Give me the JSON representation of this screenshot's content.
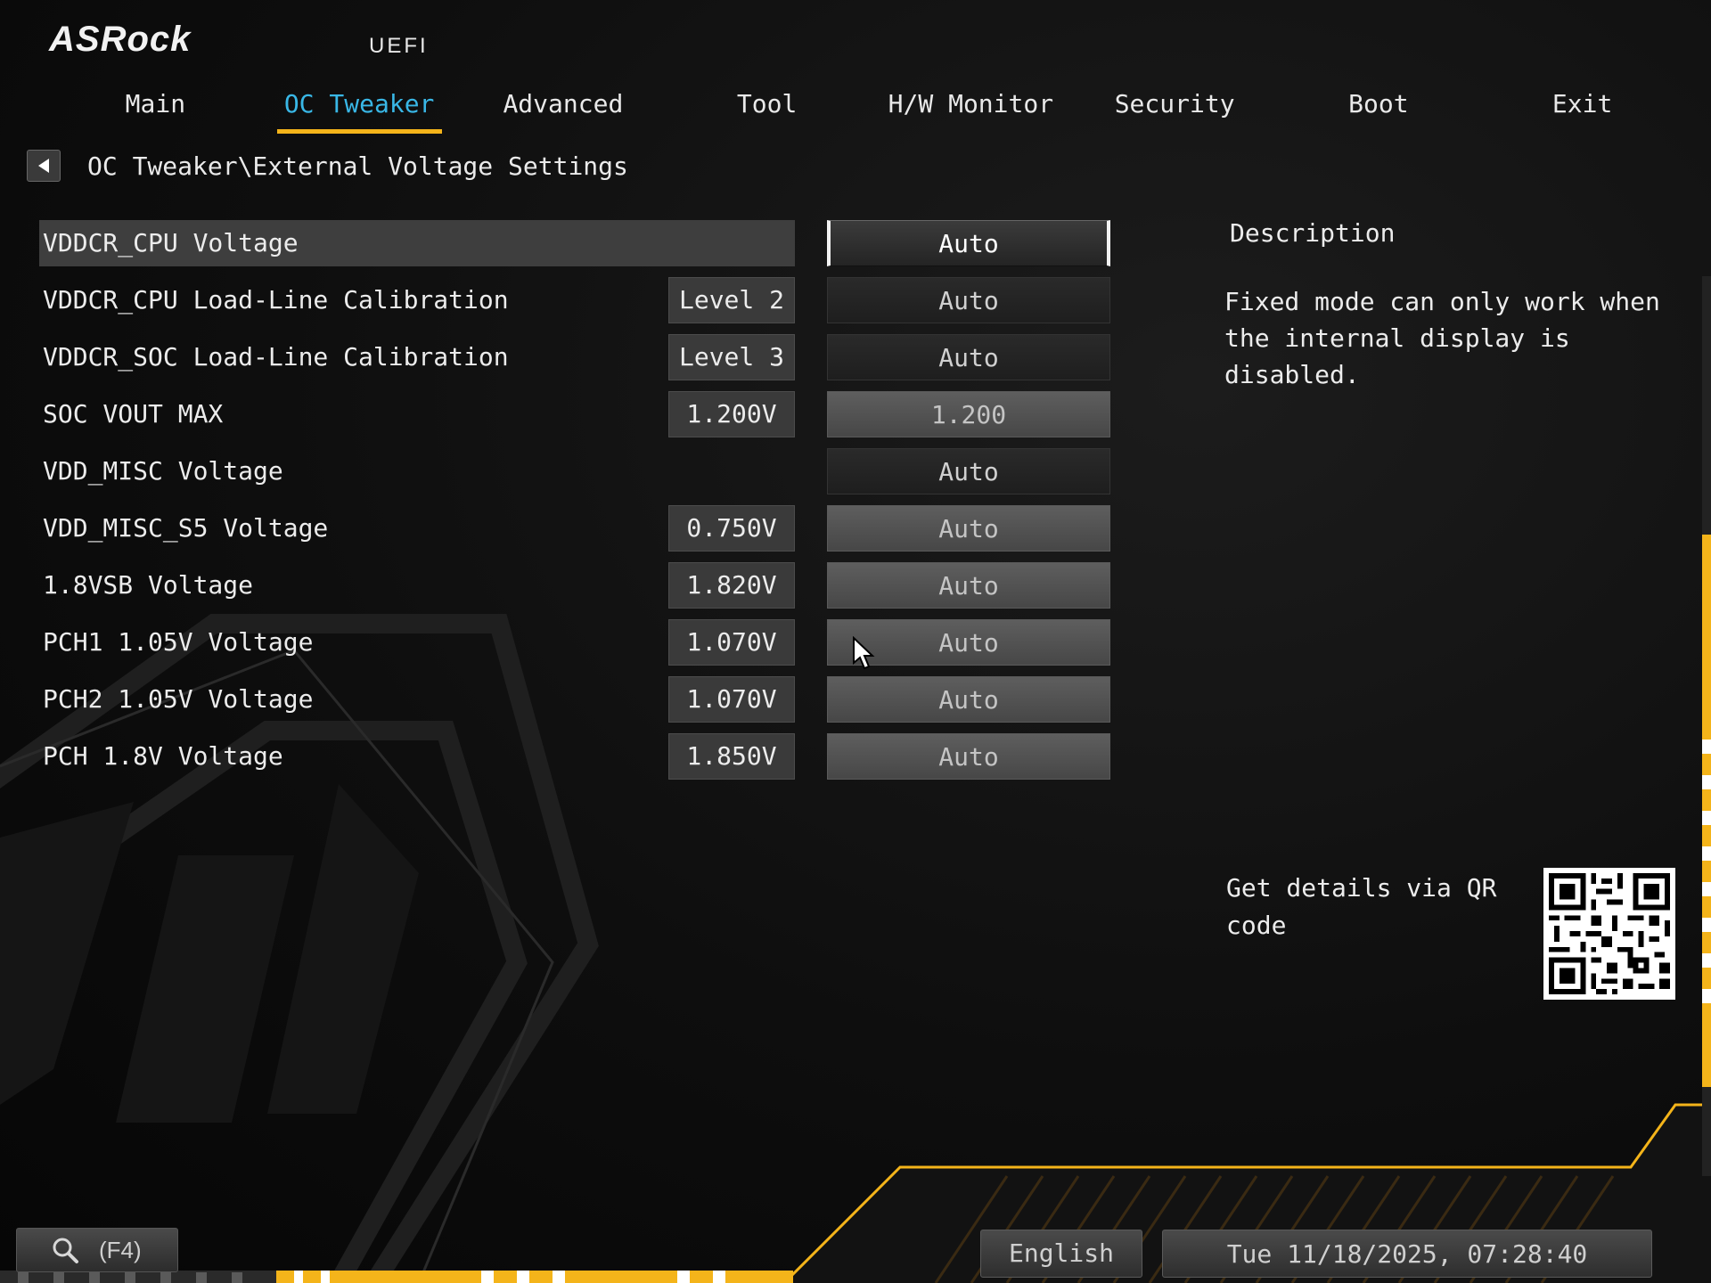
{
  "header": {
    "brand": "ASRock",
    "subtitle": "UEFI"
  },
  "tabs": [
    {
      "label": "Main"
    },
    {
      "label": "OC Tweaker",
      "active": true
    },
    {
      "label": "Advanced"
    },
    {
      "label": "Tool"
    },
    {
      "label": "H/W Monitor"
    },
    {
      "label": "Security"
    },
    {
      "label": "Boot"
    },
    {
      "label": "Exit"
    }
  ],
  "breadcrumb": "OC Tweaker\\External Voltage Settings",
  "settings": [
    {
      "label": "VDDCR_CPU Voltage",
      "current": "",
      "value": "Auto"
    },
    {
      "label": "VDDCR_CPU Load-Line Calibration",
      "current": "Level 2",
      "value": "Auto"
    },
    {
      "label": "VDDCR_SOC Load-Line Calibration",
      "current": "Level 3",
      "value": "Auto"
    },
    {
      "label": "SOC VOUT MAX",
      "current": "1.200V",
      "value": "1.200"
    },
    {
      "label": "VDD_MISC Voltage",
      "current": "",
      "value": "Auto"
    },
    {
      "label": "VDD_MISC_S5 Voltage",
      "current": "0.750V",
      "value": "Auto"
    },
    {
      "label": "1.8VSB Voltage",
      "current": "1.820V",
      "value": "Auto"
    },
    {
      "label": "PCH1 1.05V Voltage",
      "current": "1.070V",
      "value": "Auto"
    },
    {
      "label": "PCH2 1.05V Voltage",
      "current": "1.070V",
      "value": "Auto"
    },
    {
      "label": "PCH 1.8V Voltage",
      "current": "1.850V",
      "value": "Auto"
    }
  ],
  "description": {
    "title": "Description",
    "text": "Fixed mode can only work when the internal display is disabled.",
    "qr_text": "Get details via QR code"
  },
  "footer": {
    "search_label": "(F4)",
    "language": "English",
    "datetime": "Tue 11/18/2025, 07:28:40"
  },
  "colors": {
    "accent": "#f4b41a",
    "active_tab": "#39b7e6"
  }
}
